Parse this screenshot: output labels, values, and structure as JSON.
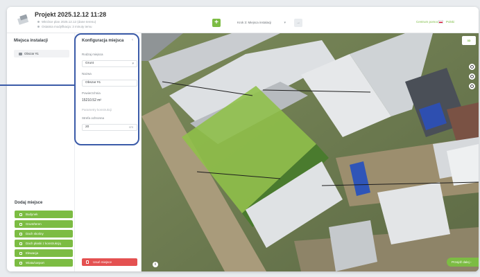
{
  "header": {
    "project_title": "Projekt 2025.12.12 11:28",
    "subtitle_1": "Wkrótce plan 2025.12.12 (dane terenu)",
    "subtitle_2": "Ostatnia modyfikacja: 3 minuty temu",
    "stage_select": "Krok 3: Miejsca instalacji",
    "help_link": "Centrum pomocy",
    "language": "Polski"
  },
  "sidebar": {
    "title": "Miejsca instalacji",
    "items": [
      {
        "label": "Obszar #1"
      }
    ],
    "add_title": "Dodaj miejsce",
    "add_buttons": [
      {
        "label": "Budynek"
      },
      {
        "label": "Grunt/teren"
      },
      {
        "label": "Dach skośny"
      },
      {
        "label": "Dach płaski z konstrukcją"
      },
      {
        "label": "Elewacja"
      },
      {
        "label": "Wiata/carport"
      }
    ]
  },
  "config": {
    "title": "Konfiguracja miejsca",
    "type_label": "Rodzaj miejsca",
    "type_value": "Grunt",
    "name_label": "Nazwa",
    "name_value": "Obszar #1",
    "area_label": "Powierzchnia",
    "area_value": "15210.52 m²",
    "dimensions_label": "Parametry konstrukcji",
    "buffer_label": "Strefa ochronna",
    "buffer_value": "20",
    "buffer_unit": "cm",
    "delete_label": "Usuń miejsce"
  },
  "map": {
    "layer_toggle": "3D",
    "next_button": "Przejdź dalej"
  },
  "colors": {
    "accent_green": "#7cbc43",
    "delete_red": "#e45151",
    "annotation_blue": "#3a5aa8"
  }
}
